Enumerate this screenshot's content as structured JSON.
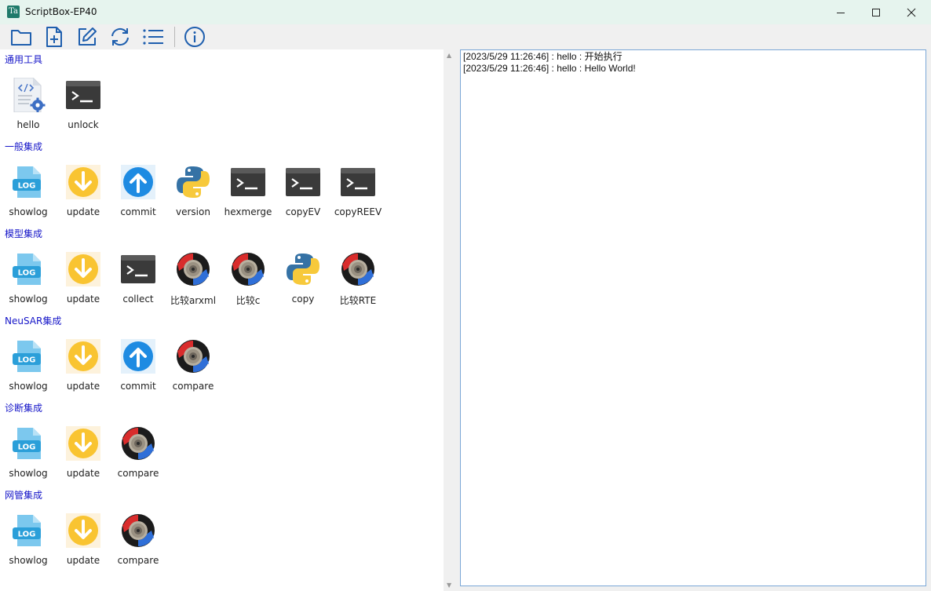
{
  "window": {
    "title": "ScriptBox-EP40",
    "icon_text": "Ta"
  },
  "toolbar": {
    "buttons": [
      {
        "name": "open-folder",
        "icon": "folder-icon"
      },
      {
        "name": "new-file",
        "icon": "file-plus-icon"
      },
      {
        "name": "edit",
        "icon": "edit-icon"
      },
      {
        "name": "refresh",
        "icon": "refresh-icon"
      },
      {
        "name": "list",
        "icon": "list-icon"
      },
      {
        "name": "info",
        "icon": "info-icon"
      }
    ]
  },
  "groups": [
    {
      "title": "通用工具",
      "items": [
        {
          "label": "hello",
          "icon": "script-file-icon"
        },
        {
          "label": "unlock",
          "icon": "terminal-icon"
        }
      ]
    },
    {
      "title": "一般集成",
      "items": [
        {
          "label": "showlog",
          "icon": "log-file-icon"
        },
        {
          "label": "update",
          "icon": "download-arrow-icon"
        },
        {
          "label": "commit",
          "icon": "upload-arrow-icon"
        },
        {
          "label": "version",
          "icon": "python-icon"
        },
        {
          "label": "hexmerge",
          "icon": "terminal-icon"
        },
        {
          "label": "copyEV",
          "icon": "terminal-icon"
        },
        {
          "label": "copyREEV",
          "icon": "terminal-icon"
        }
      ]
    },
    {
      "title": "模型集成",
      "items": [
        {
          "label": "showlog",
          "icon": "log-file-icon"
        },
        {
          "label": "update",
          "icon": "download-arrow-icon"
        },
        {
          "label": "collect",
          "icon": "terminal-icon"
        },
        {
          "label": "比较arxml",
          "icon": "compare-icon"
        },
        {
          "label": "比较c",
          "icon": "compare-icon"
        },
        {
          "label": "copy",
          "icon": "python-icon"
        },
        {
          "label": "比较RTE",
          "icon": "compare-icon"
        }
      ]
    },
    {
      "title": "NeuSAR集成",
      "items": [
        {
          "label": "showlog",
          "icon": "log-file-icon"
        },
        {
          "label": "update",
          "icon": "download-arrow-icon"
        },
        {
          "label": "commit",
          "icon": "upload-arrow-icon"
        },
        {
          "label": "compare",
          "icon": "compare-icon"
        }
      ]
    },
    {
      "title": "诊断集成",
      "items": [
        {
          "label": "showlog",
          "icon": "log-file-icon"
        },
        {
          "label": "update",
          "icon": "download-arrow-icon"
        },
        {
          "label": "compare",
          "icon": "compare-icon"
        }
      ]
    },
    {
      "title": "网管集成",
      "items": [
        {
          "label": "showlog",
          "icon": "log-file-icon"
        },
        {
          "label": "update",
          "icon": "download-arrow-icon"
        },
        {
          "label": "compare",
          "icon": "compare-icon"
        }
      ]
    }
  ],
  "log": {
    "lines": [
      "[2023/5/29 11:26:46] : hello : 开始执行",
      "[2023/5/29 11:26:46] : hello : Hello World!"
    ]
  },
  "colors": {
    "title_bar": "#e6f4ee",
    "group_title": "#1515c8",
    "log_border": "#7aa7d6"
  }
}
